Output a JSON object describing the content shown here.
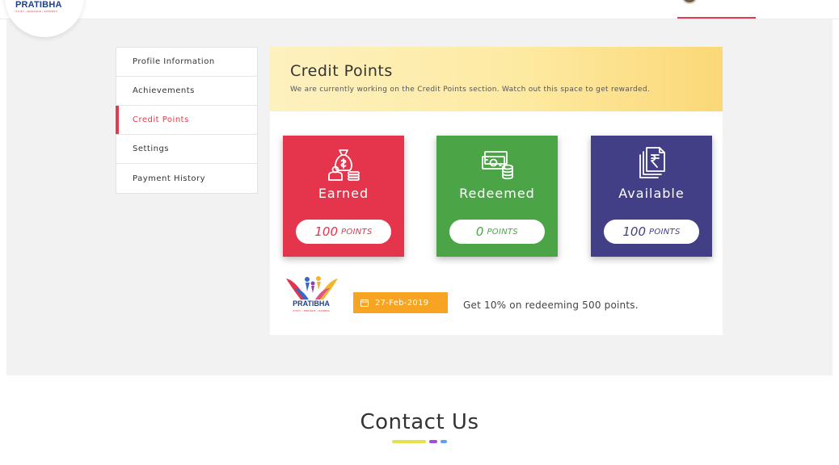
{
  "brand": {
    "name": "PRATIBHA",
    "tagline": "STUDY • ENHANCE • EXPRESS"
  },
  "sidebar": {
    "items": [
      {
        "label": "Profile Information"
      },
      {
        "label": "Achievements"
      },
      {
        "label": "Credit Points",
        "active": true
      },
      {
        "label": "Settings"
      },
      {
        "label": "Payment History"
      }
    ]
  },
  "credit": {
    "title": "Credit Points",
    "subtitle": "We are currently working on the Credit Points section. Watch out this space to get rewarded."
  },
  "cards": [
    {
      "label": "Earned",
      "points": "100",
      "unit": "POINTS",
      "color": "#e4354c",
      "icon": "money-bag-icon"
    },
    {
      "label": "Redeemed",
      "points": "0",
      "unit": "POINTS",
      "color": "#4ba546",
      "icon": "cash-coins-icon"
    },
    {
      "label": "Available",
      "points": "100",
      "unit": "POINTS",
      "color": "#433f87",
      "icon": "rupee-documents-icon"
    }
  ],
  "offer": {
    "logo_text": "PRATIBHA",
    "date": "27-Feb-2019",
    "text": "Get 10% on redeeming 500 points."
  },
  "contact": {
    "title": "Contact Us"
  },
  "colors": {
    "accent": "#e23b4f",
    "banner": "#fbd877",
    "date_badge": "#f7a423"
  }
}
